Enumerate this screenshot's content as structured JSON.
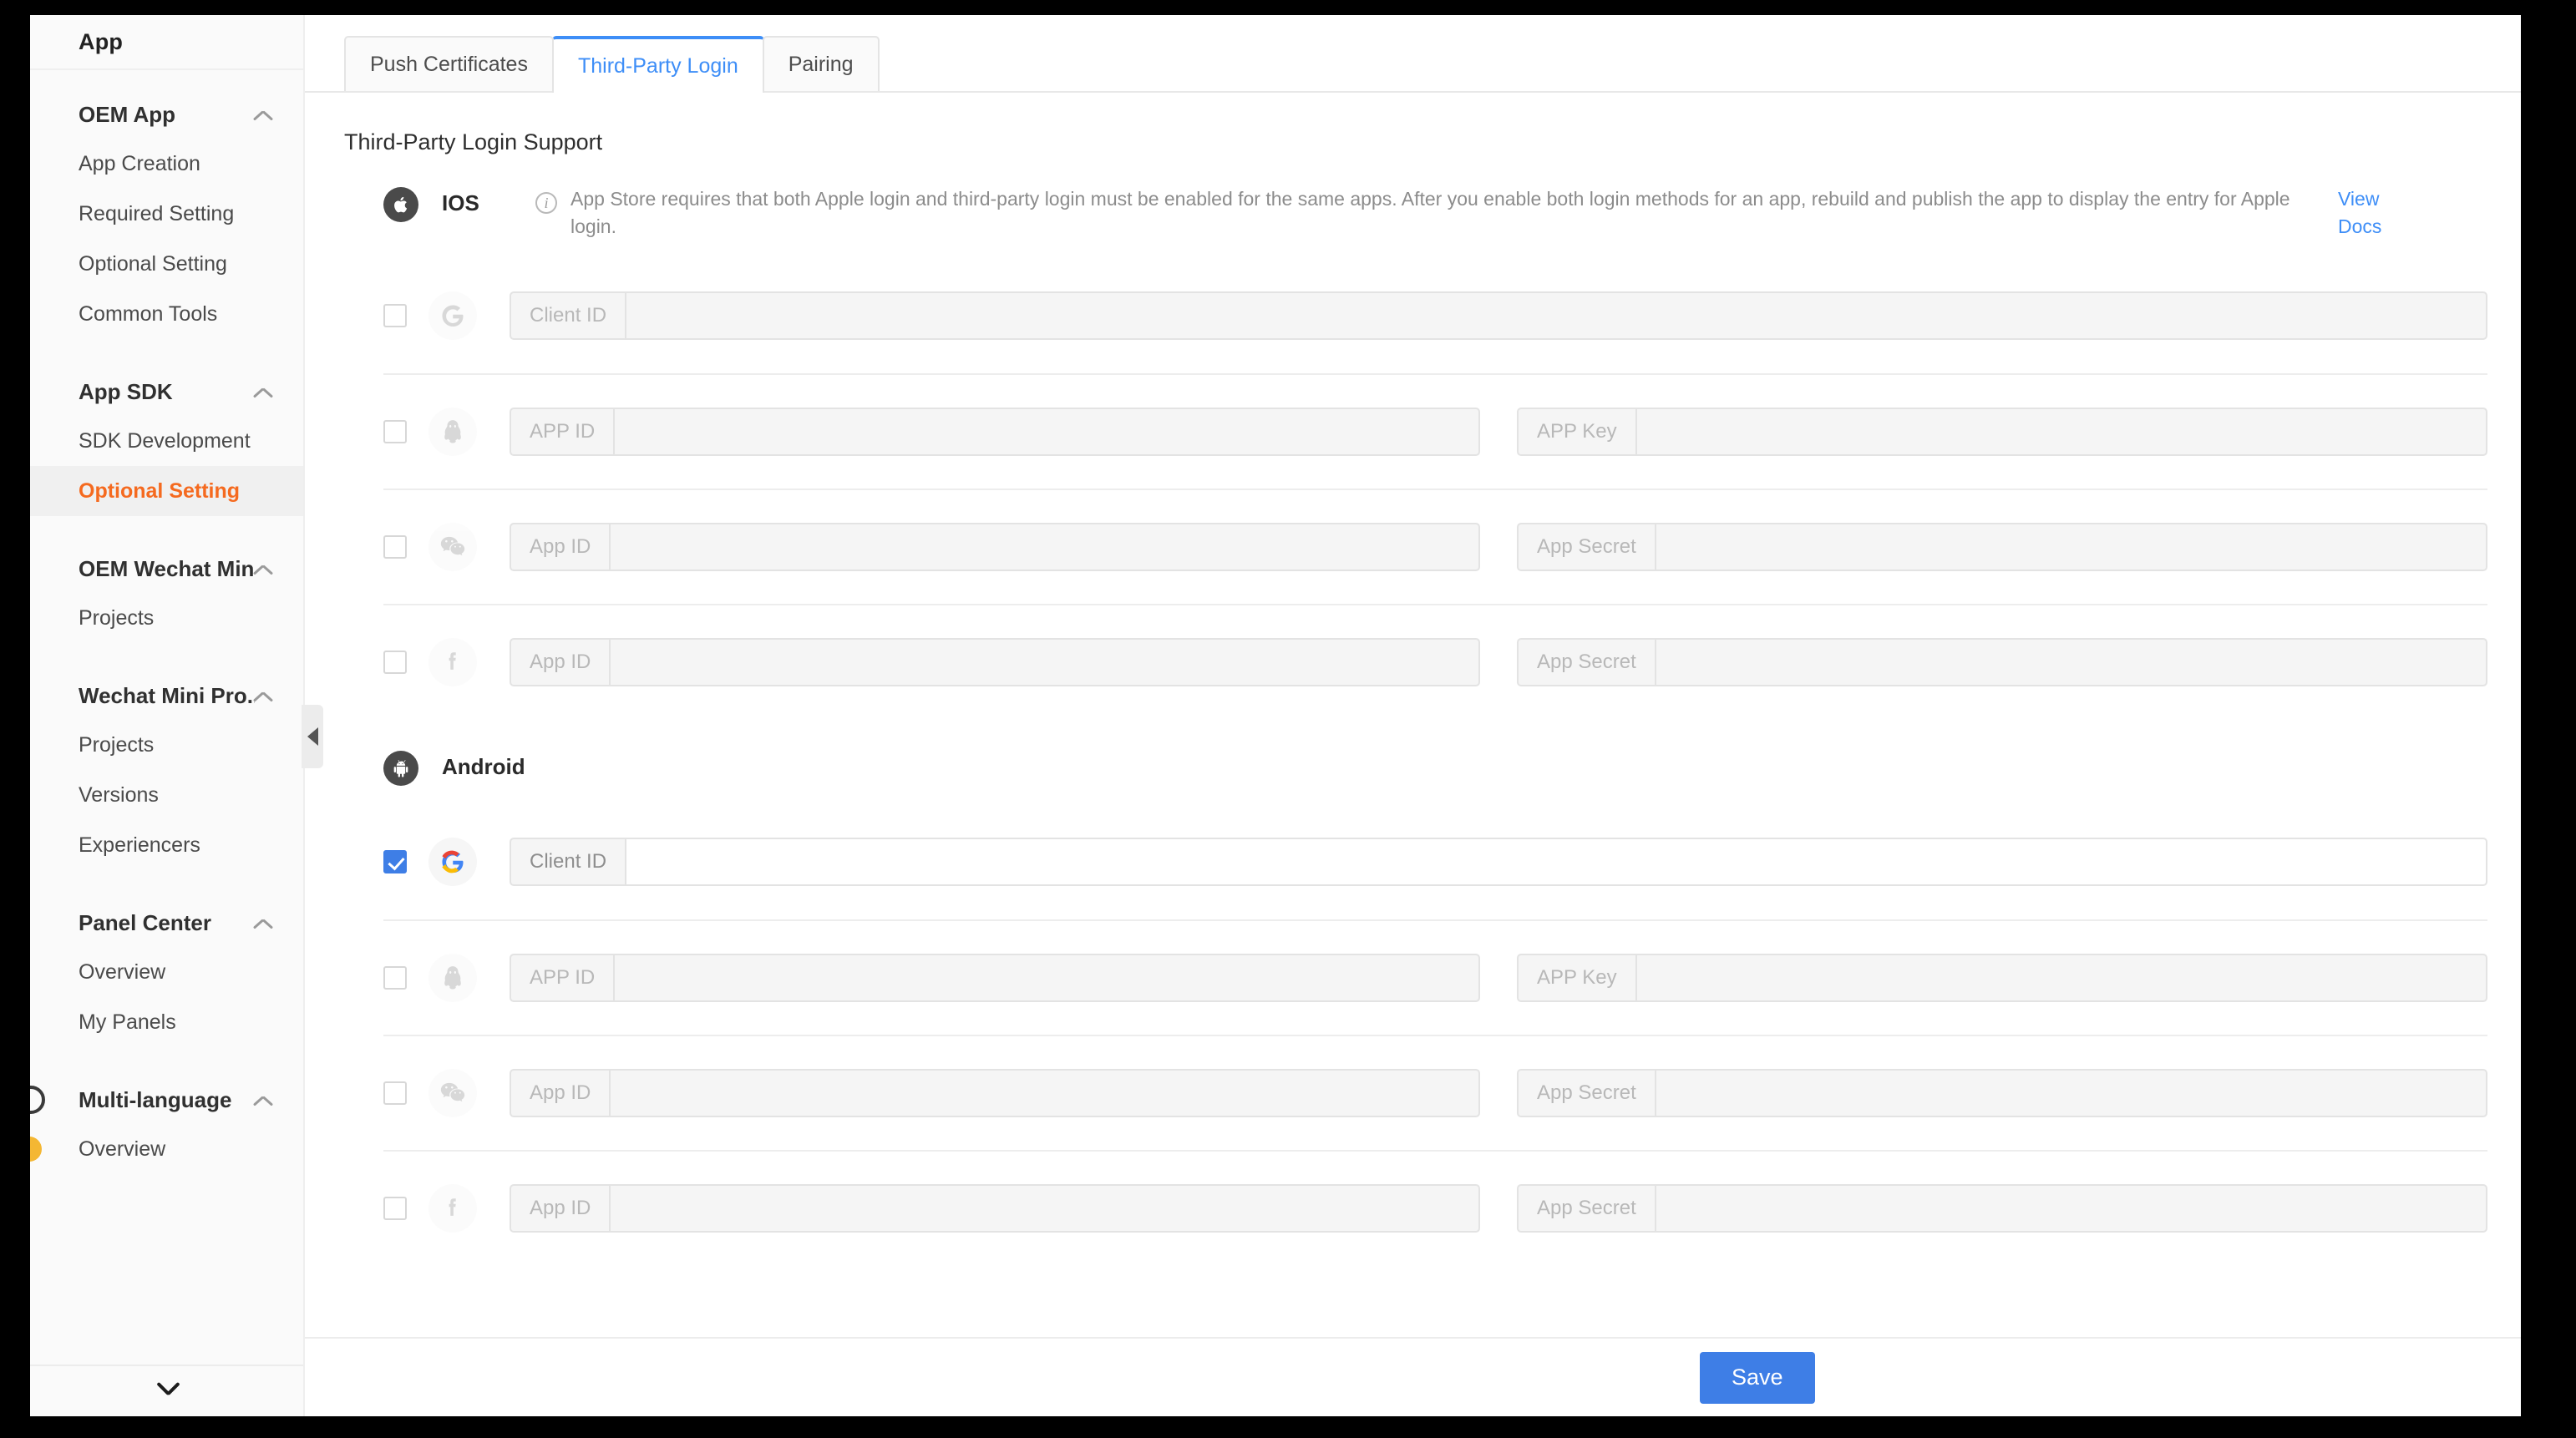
{
  "sidebar": {
    "header_title": "App",
    "collapse_handle_icon": "triangle-left-icon",
    "footer_icon": "chevron-down-icon",
    "groups": [
      {
        "title": "OEM App",
        "toggle_icon": "chevron-up-icon",
        "items": [
          {
            "label": "App Creation",
            "active": false
          },
          {
            "label": "Required Setting",
            "active": false
          },
          {
            "label": "Optional Setting",
            "active": false
          },
          {
            "label": "Common Tools",
            "active": false
          }
        ]
      },
      {
        "title": "App SDK",
        "toggle_icon": "chevron-up-icon",
        "items": [
          {
            "label": "SDK Development",
            "active": false
          },
          {
            "label": "Optional Setting",
            "active": true
          }
        ]
      },
      {
        "title": "OEM Wechat Min...",
        "toggle_icon": "chevron-up-icon",
        "items": [
          {
            "label": "Projects",
            "active": false
          }
        ]
      },
      {
        "title": "Wechat Mini Pro...",
        "toggle_icon": "chevron-up-icon",
        "items": [
          {
            "label": "Projects",
            "active": false
          },
          {
            "label": "Versions",
            "active": false
          },
          {
            "label": "Experiencers",
            "active": false
          }
        ]
      },
      {
        "title": "Panel Center",
        "toggle_icon": "chevron-up-icon",
        "items": [
          {
            "label": "Overview",
            "active": false
          },
          {
            "label": "My Panels",
            "active": false
          }
        ]
      },
      {
        "title": "Multi-language",
        "toggle_icon": "chevron-up-icon",
        "items": [
          {
            "label": "Overview",
            "active": false
          }
        ]
      }
    ]
  },
  "tabs": [
    {
      "label": "Push Certificates",
      "active": false
    },
    {
      "label": "Third-Party Login",
      "active": true
    },
    {
      "label": "Pairing",
      "active": false
    }
  ],
  "main": {
    "section_title": "Third-Party Login Support",
    "accent_color": "#3e8ef7",
    "save_label": "Save"
  },
  "platforms": [
    {
      "name": "IOS",
      "icon": "apple-icon",
      "info_icon": "info-icon",
      "description": "App Store requires that both Apple login and third-party login must be enabled for the same apps. After you enable both login methods for an app, rebuild and publish the app to display the entry for Apple login.",
      "docs_link": "View Docs",
      "providers": [
        {
          "provider": "google",
          "icon": "google-icon",
          "checked": false,
          "enabled": false,
          "fields": [
            {
              "label": "Client ID",
              "value": ""
            }
          ]
        },
        {
          "provider": "qq",
          "icon": "qq-icon",
          "checked": false,
          "enabled": false,
          "fields": [
            {
              "label": "APP ID",
              "value": ""
            },
            {
              "label": "APP Key",
              "value": ""
            }
          ]
        },
        {
          "provider": "wechat",
          "icon": "wechat-icon",
          "checked": false,
          "enabled": false,
          "fields": [
            {
              "label": "App ID",
              "value": ""
            },
            {
              "label": "App Secret",
              "value": ""
            }
          ]
        },
        {
          "provider": "facebook",
          "icon": "facebook-icon",
          "checked": false,
          "enabled": false,
          "fields": [
            {
              "label": "App ID",
              "value": ""
            },
            {
              "label": "App Secret",
              "value": ""
            }
          ]
        }
      ]
    },
    {
      "name": "Android",
      "icon": "android-icon",
      "info_icon": "",
      "description": "",
      "docs_link": "",
      "providers": [
        {
          "provider": "google",
          "icon": "google-icon",
          "checked": true,
          "enabled": true,
          "fields": [
            {
              "label": "Client ID",
              "value": ""
            }
          ]
        },
        {
          "provider": "qq",
          "icon": "qq-icon",
          "checked": false,
          "enabled": false,
          "fields": [
            {
              "label": "APP ID",
              "value": ""
            },
            {
              "label": "APP Key",
              "value": ""
            }
          ]
        },
        {
          "provider": "wechat",
          "icon": "wechat-icon",
          "checked": false,
          "enabled": false,
          "fields": [
            {
              "label": "App ID",
              "value": ""
            },
            {
              "label": "App Secret",
              "value": ""
            }
          ]
        },
        {
          "provider": "facebook",
          "icon": "facebook-icon",
          "checked": false,
          "enabled": false,
          "fields": [
            {
              "label": "App ID",
              "value": ""
            },
            {
              "label": "App Secret",
              "value": ""
            }
          ]
        }
      ]
    }
  ]
}
